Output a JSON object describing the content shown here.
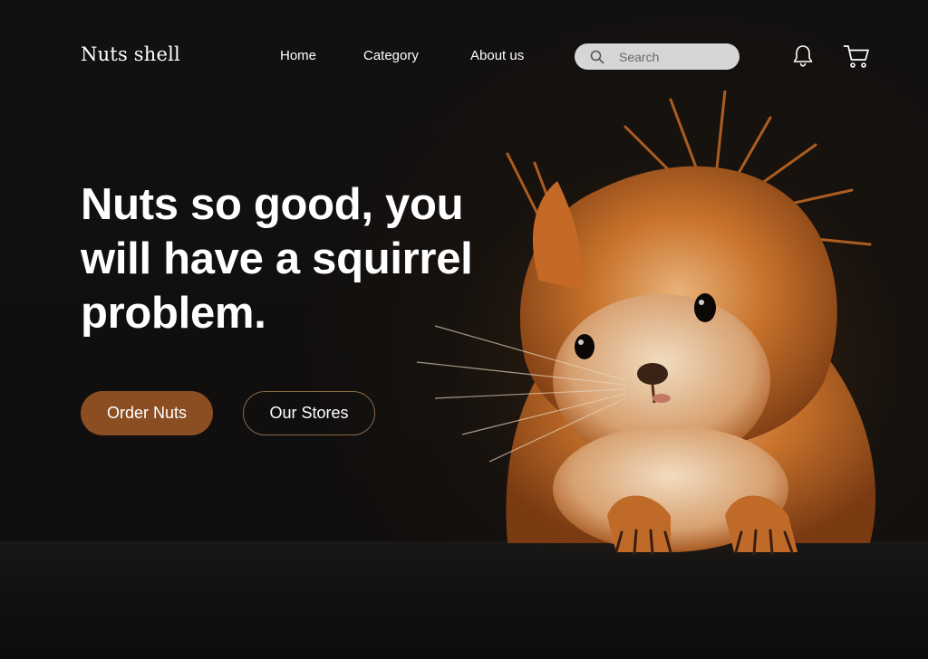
{
  "header": {
    "logo": "Nuts shell",
    "nav": [
      "Home",
      "Category",
      "About us"
    ],
    "search_placeholder": "Search",
    "icons": [
      "search-icon",
      "bell-icon",
      "cart-icon"
    ]
  },
  "hero": {
    "headline_lines": [
      "Nuts so good, you",
      "will have a squirrel",
      "problem."
    ],
    "primary_button": "Order Nuts",
    "secondary_button": "Our Stores"
  },
  "colors": {
    "background": "#0f0d0c",
    "accent": "#8a4e22",
    "outline": "#8a6a48",
    "search_bg": "#d6d6d6"
  }
}
